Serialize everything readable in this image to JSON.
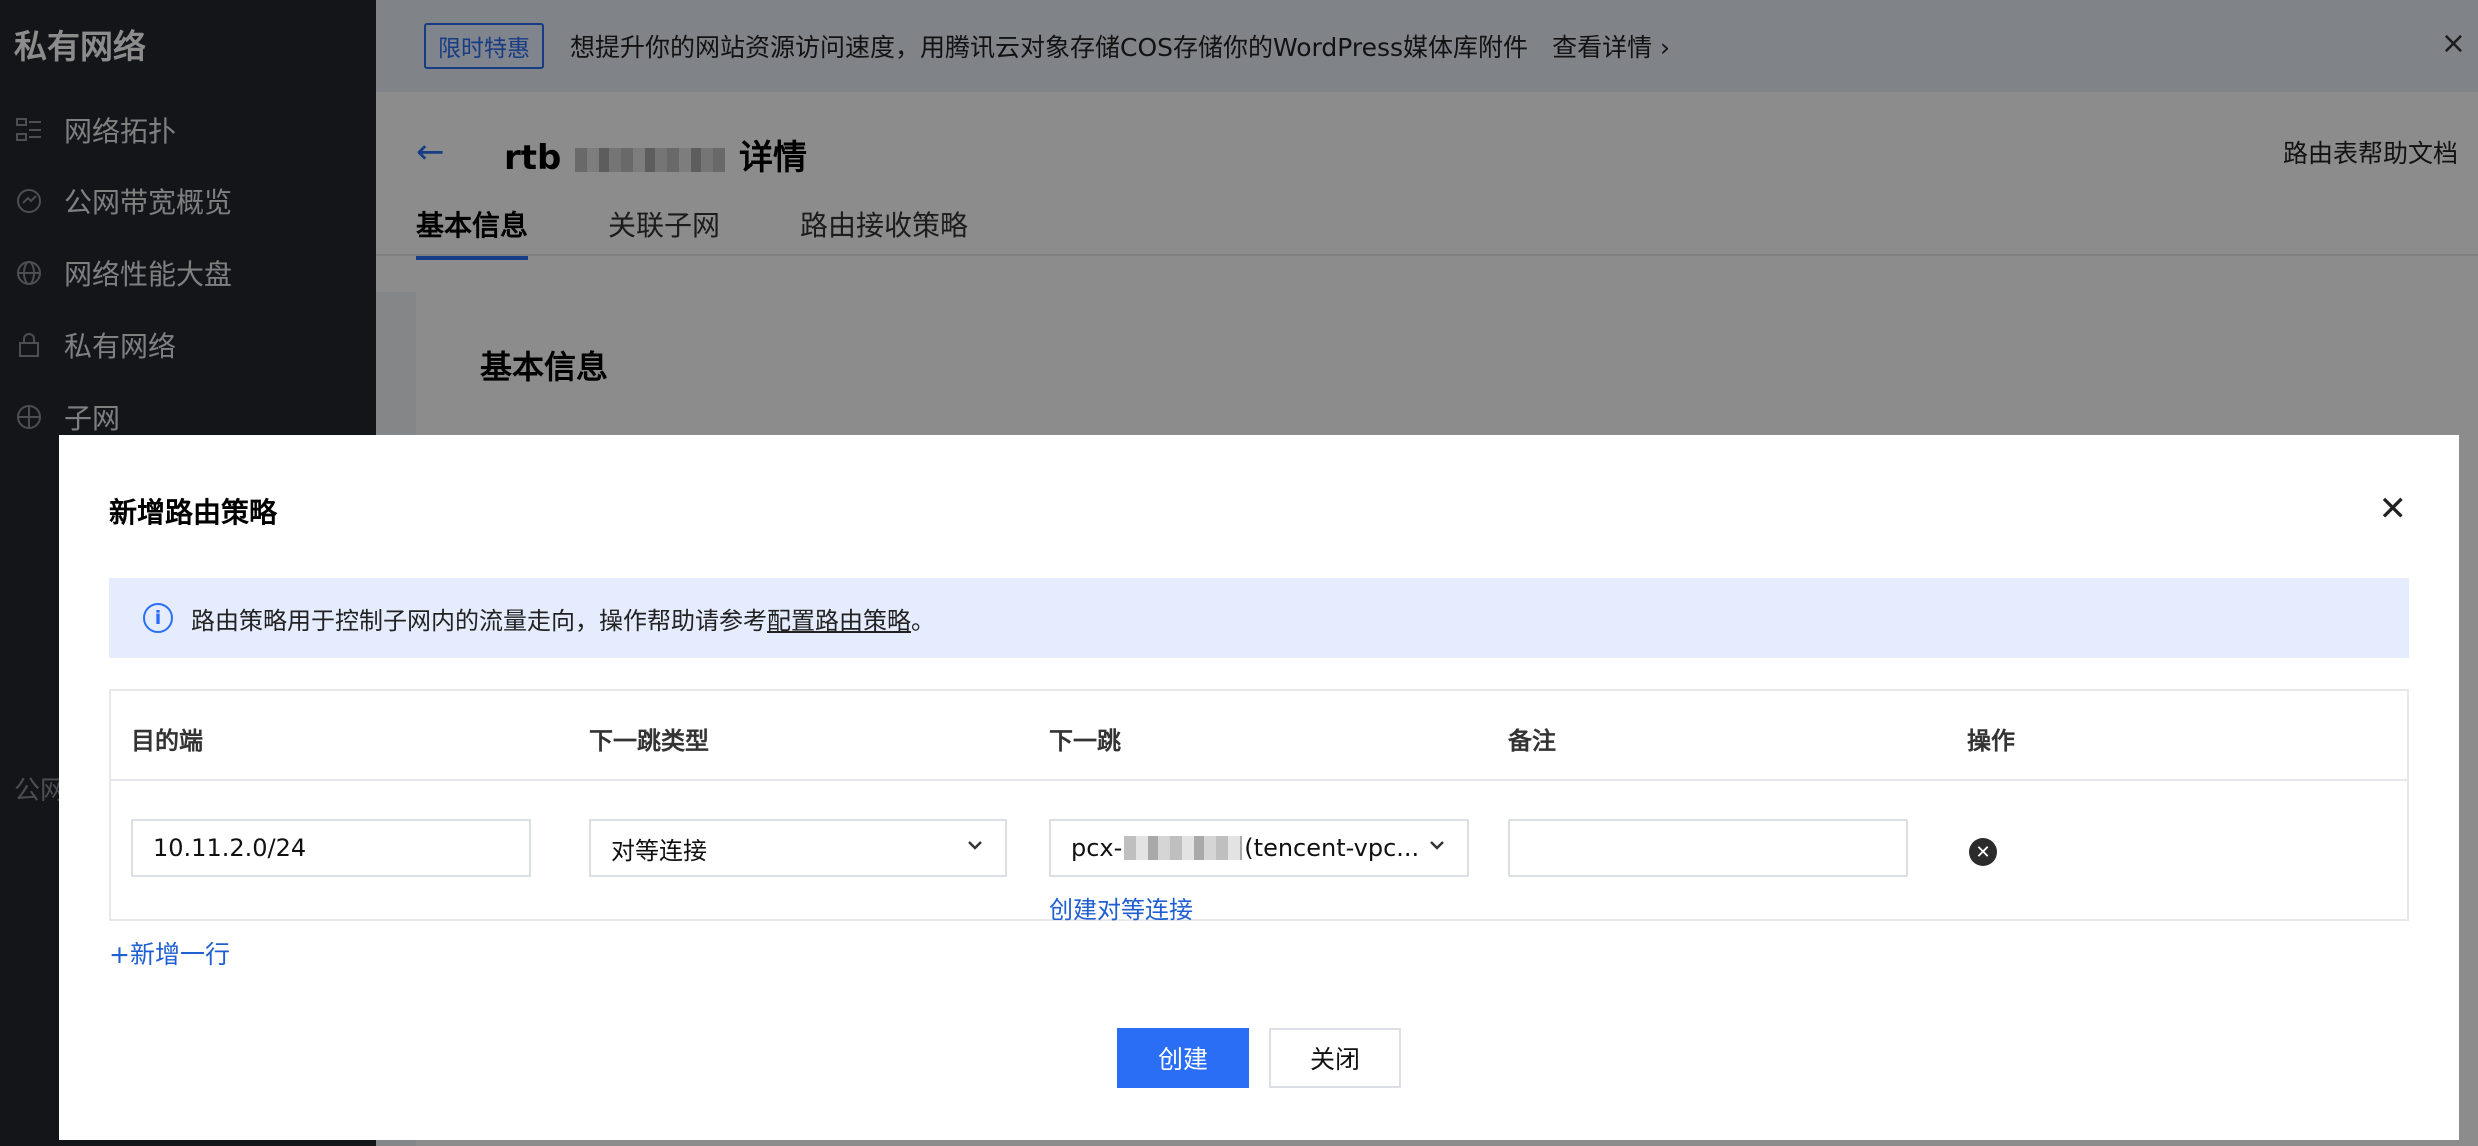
{
  "sidebar": {
    "title": "私有网络",
    "items": [
      {
        "label": "网络拓扑",
        "icon": "topology-icon"
      },
      {
        "label": "公网带宽概览",
        "icon": "bandwidth-icon"
      },
      {
        "label": "网络性能大盘",
        "icon": "performance-icon"
      },
      {
        "label": "私有网络",
        "icon": "lock-icon"
      },
      {
        "label": "子网",
        "icon": "globe-icon"
      }
    ],
    "partial_label": "公网"
  },
  "banner": {
    "tag": "限时特惠",
    "text": "想提升你的网站资源访问速度，用腾讯云对象存储COS存储你的WordPress媒体库附件",
    "link": "查看详情 ›",
    "close": "×"
  },
  "detail": {
    "back": "←",
    "title_prefix": "rtb",
    "title_suffix": "详情",
    "help_doc": "路由表帮助文档",
    "tabs": [
      "基本信息",
      "关联子网",
      "路由接收策略"
    ],
    "section_title": "基本信息"
  },
  "modal": {
    "title": "新增路由策略",
    "close": "✕",
    "info_text": "路由策略用于控制子网内的流量走向，操作帮助请参考",
    "info_link": "配置路由策略",
    "info_end": "。",
    "columns": [
      "目的端",
      "下一跳类型",
      "下一跳",
      "备注",
      "操作"
    ],
    "row": {
      "destination": "10.11.2.0/24",
      "next_hop_type": "对等连接",
      "next_hop_prefix": "pcx-",
      "next_hop_suffix": "(tencent-vpc...",
      "remark": ""
    },
    "create_peer_link": "创建对等连接",
    "add_row": "+新增一行",
    "create_button": "创建",
    "close_button": "关闭"
  }
}
